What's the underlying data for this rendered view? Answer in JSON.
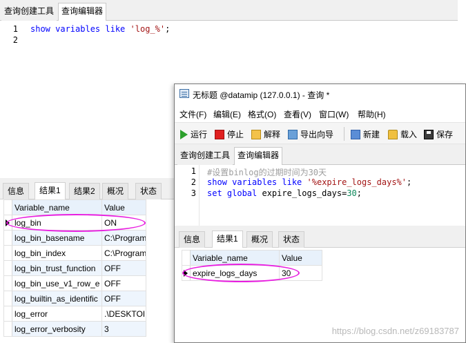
{
  "bg": {
    "tabs": [
      "查询创建工具",
      "查询编辑器"
    ],
    "active_tab": "查询编辑器",
    "line_numbers": [
      "1",
      "2"
    ],
    "code": {
      "kw": "show variables like",
      "str": "'log_%'",
      "end": ";"
    },
    "result_tabs": [
      "信息",
      "结果1",
      "结果2",
      "概况",
      "状态"
    ],
    "active_result_tab": "结果1",
    "columns": [
      "Variable_name",
      "Value"
    ],
    "rows": [
      [
        "log_bin",
        "ON"
      ],
      [
        "log_bin_basename",
        "C:\\Program"
      ],
      [
        "log_bin_index",
        "C:\\Program"
      ],
      [
        "log_bin_trust_function",
        "OFF"
      ],
      [
        "log_bin_use_v1_row_e",
        "OFF"
      ],
      [
        "log_builtin_as_identific",
        "OFF"
      ],
      [
        "log_error",
        ".\\DESKTOI"
      ],
      [
        "log_error_verbosity",
        "3"
      ]
    ]
  },
  "fg": {
    "title": "无标题 @datamip (127.0.0.1) - 查询 *",
    "menu": [
      "文件(F)",
      "编辑(E)",
      "格式(O)",
      "查看(V)",
      "窗口(W)",
      "帮助(H)"
    ],
    "toolbar": {
      "run": "运行",
      "stop": "停止",
      "explain": "解释",
      "export": "导出向导",
      "new": "新建",
      "load": "载入",
      "save": "保存"
    },
    "tabs": [
      "查询创建工具",
      "查询编辑器"
    ],
    "active_tab": "查询编辑器",
    "line_numbers": [
      "1",
      "2",
      "3"
    ],
    "code": {
      "line1_comment": "#设置binlog的过期时间为30天",
      "line2_kw": "show variables like",
      "line2_str": "'%expire_logs_days%'",
      "line2_end": ";",
      "line3_kw": "set global",
      "line3_plain": "expire_logs_days=",
      "line3_num": "30",
      "line3_end": ";"
    },
    "result_tabs": [
      "信息",
      "结果1",
      "概况",
      "状态"
    ],
    "active_result_tab": "结果1",
    "columns": [
      "Variable_name",
      "Value"
    ],
    "rows": [
      [
        "expire_logs_days",
        "30"
      ]
    ]
  },
  "highlight_color": "#e81ee0",
  "watermark": "https://blog.csdn.net/z69183787"
}
